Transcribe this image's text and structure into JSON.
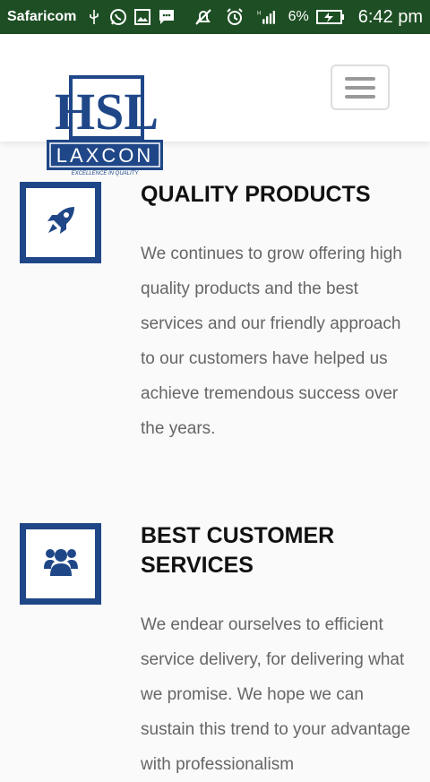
{
  "status_bar": {
    "carrier": "Safaricom",
    "battery": "6%",
    "time": "6:42 pm",
    "left_icons": [
      "usb-icon",
      "whatsapp-icon",
      "image-icon",
      "message-icon"
    ],
    "right_icons": [
      "mute-icon",
      "alarm-icon",
      "signal-icon",
      "battery-icon"
    ]
  },
  "header": {
    "logo_text_top": "HSL",
    "logo_text_main": "LAXCON",
    "logo_tagline": "EXCELLENCE IN QUALITY",
    "brand_color": "#1f4788"
  },
  "features": [
    {
      "icon": "rocket-icon",
      "title": "QUALITY PRODUCTS",
      "text": "We continues to grow offering high quality products and the best services and our friendly approach to our customers have helped us achieve tremendous success over the years."
    },
    {
      "icon": "users-icon",
      "title": "BEST CUSTOMER SERVICES",
      "text": "We endear ourselves to efficient service delivery, for delivering what we promise. We hope we can sustain this trend to your advantage with professionalism"
    }
  ]
}
